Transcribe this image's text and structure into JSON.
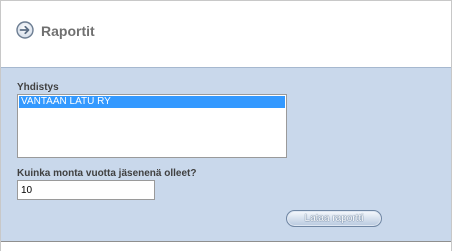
{
  "header": {
    "title": "Raportit",
    "icon": "arrow-right-circle-icon"
  },
  "form": {
    "association_label": "Yhdistys",
    "association_options": [
      "VANTAAN LATU RY"
    ],
    "association_selected": "VANTAAN LATU RY",
    "years_label": "Kuinka monta vuotta jäsenenä olleet?",
    "years_value": "10",
    "submit_label": "Lataa raportti"
  },
  "colors": {
    "form_background": "#c9d8eb",
    "selection": "#3399ff",
    "title_text": "#707070"
  }
}
